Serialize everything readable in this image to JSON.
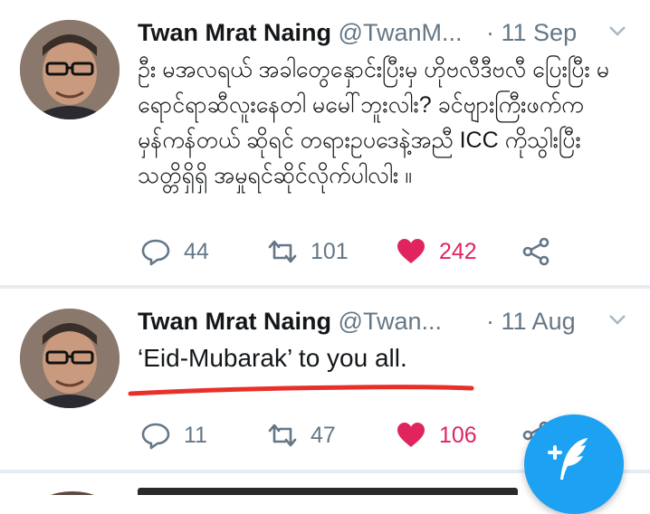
{
  "colors": {
    "accent": "#1da1f2",
    "like": "#e0245e",
    "muted": "#657786",
    "annotation_underline": "#e8302a"
  },
  "tweets": [
    {
      "name": "Twan Mrat Naing",
      "handle": "@TwanM...",
      "separator": "·",
      "date": "11 Sep",
      "text": "ဦး မအလရယ် အခါတွေနှောင်းပြီးမှ ဟိုဗလီဒီဗလီ ပြေးပြီး မရောင်ရာဆီလူးနေတါ မမေါ်ဘူးလါး? ခင်ဗျားကြီးဖက်က မှန်ကန်တယ် ဆိုရင် တရားဥပဒေနဲ့အညီ ICC ကိုသွါးပြီးသတ္တိရှိရှိ အမှုရင်ဆိုင်လိုက်ပါလါး ။",
      "reply_count": "44",
      "retweet_count": "101",
      "like_count": "242",
      "icons": [
        "reply-icon",
        "retweet-icon",
        "heart-icon",
        "share-icon"
      ]
    },
    {
      "name": "Twan Mrat Naing",
      "handle": "@Twan...",
      "separator": "·",
      "date": "11 Aug",
      "text": "‘Eid-Mubarak’ to you all.",
      "reply_count": "11",
      "retweet_count": "47",
      "like_count": "106",
      "icons": [
        "reply-icon",
        "retweet-icon",
        "heart-icon",
        "share-icon"
      ]
    }
  ],
  "fab": {
    "icon": "compose-tweet-icon"
  }
}
